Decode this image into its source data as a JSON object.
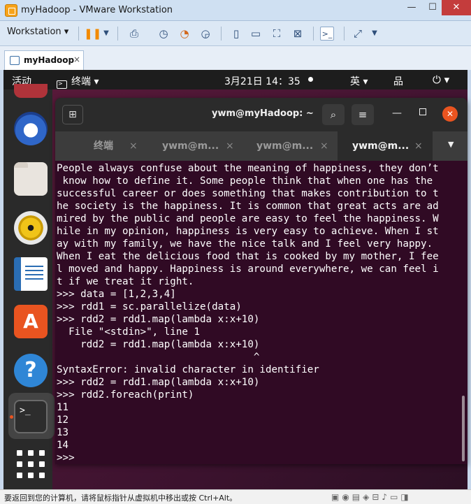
{
  "vm": {
    "title": "myHadoop - VMware Workstation",
    "workstation_menu": "Workstation ▾",
    "tab_label": "myHadoop",
    "tab_close": "×",
    "status_text": "要返回到您的计算机，请将鼠标指针从虚拟机中移出或按 Ctrl+Alt。",
    "status_icons": "▣◉▤◈⊟♪▭◨"
  },
  "ubuntu": {
    "activities": "活动",
    "terminal_menu": "终端 ▾",
    "clock": "3月21日 14：35",
    "ime": "英 ▾"
  },
  "terminal": {
    "title": "ywm@myHadoop: ~",
    "tabs": [
      {
        "label": "终端",
        "close": "×"
      },
      {
        "label": "ywm@m...",
        "close": "×"
      },
      {
        "label": "ywm@m...",
        "close": "×"
      },
      {
        "label": "ywm@m...",
        "close": "×"
      }
    ],
    "lines": [
      "People always confuse about the meaning of happiness, they don’t",
      " know how to define it. Some people think that when one has the",
      "successful career or does something that makes contribution to t",
      "he society is the happiness. It is common that great acts are ad",
      "mired by the public and people are easy to feel the happiness. W",
      "hile in my opinion, happiness is very easy to achieve. When I st",
      "ay with my family, we have the nice talk and I feel very happy.",
      "When I eat the delicious food that is cooked by my mother, I fee",
      "l moved and happy. Happiness is around everywhere, we can feel i",
      "t if we treat it right.",
      ">>> data = [1,2,3,4]",
      ">>> rdd1 = sc.parallelize(data)",
      ">>> rdd2 = rdd1.map(lambda x:x+10)",
      "  File \"<stdin>\", line 1",
      "    rdd2 = rdd1.map(lambda x:x+10)",
      "                                 ^",
      "SyntaxError: invalid character in identifier",
      ">>> rdd2 = rdd1.map(lambda x:x+10)",
      ">>> rdd2.foreach(print)",
      "11",
      "12",
      "13",
      "14",
      ">>>"
    ]
  }
}
